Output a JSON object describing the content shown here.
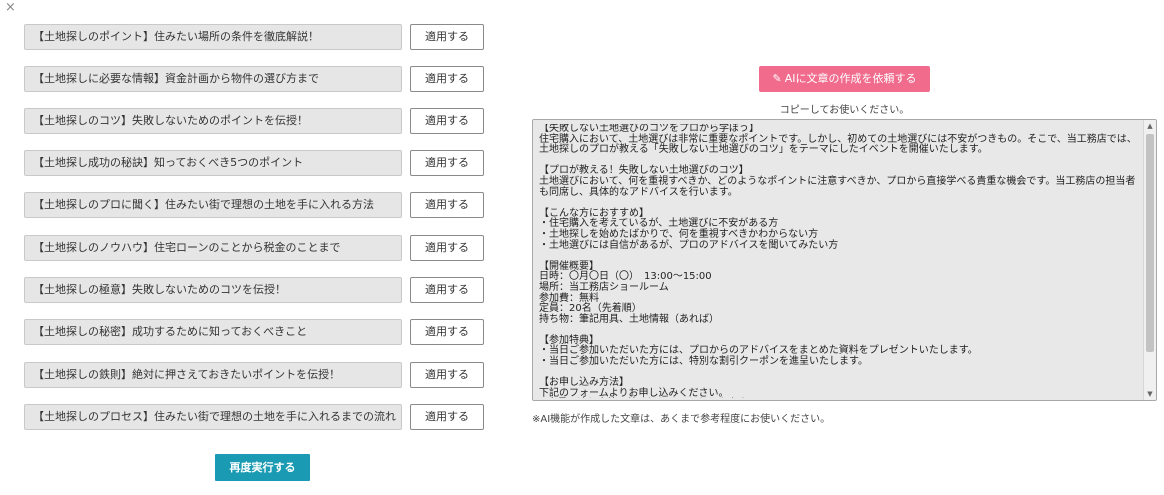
{
  "close_symbol": "×",
  "titles": [
    {
      "text": "【土地探しのポイント】住みたい場所の条件を徹底解説！",
      "apply_label": "適用する"
    },
    {
      "text": "【土地探しに必要な情報】資金計画から物件の選び方まで",
      "apply_label": "適用する"
    },
    {
      "text": "【土地探しのコツ】失敗しないためのポイントを伝授！",
      "apply_label": "適用する"
    },
    {
      "text": "【土地探し成功の秘訣】知っておくべき5つのポイント",
      "apply_label": "適用する"
    },
    {
      "text": "【土地探しのプロに聞く】住みたい街で理想の土地を手に入れる方法",
      "apply_label": "適用する"
    },
    {
      "text": "【土地探しのノウハウ】住宅ローンのことから税金のことまで",
      "apply_label": "適用する"
    },
    {
      "text": "【土地探しの極意】失敗しないためのコツを伝授！",
      "apply_label": "適用する"
    },
    {
      "text": "【土地探しの秘密】成功するために知っておくべきこと",
      "apply_label": "適用する"
    },
    {
      "text": "【土地探しの鉄則】絶対に押さえておきたいポイントを伝授！",
      "apply_label": "適用する"
    },
    {
      "text": "【土地探しのプロセス】住みたい街で理想の土地を手に入れるまでの流れ",
      "apply_label": "適用する"
    }
  ],
  "rerun_label": "再度実行する",
  "ai_button_label": "AIに文章の作成を依頼する",
  "copy_note": "コピーしてお使いください。",
  "generated_text": "【失敗しない土地選びのコツをプロから学ぼう】\n住宅購入において、土地選びは非常に重要なポイントです。しかし、初めての土地選びには不安がつきもの。そこで、当工務店では、土地探しのプロが教える「失敗しない土地選びのコツ」をテーマにしたイベントを開催いたします。\n\n【プロが教える！失敗しない土地選びのコツ】\n土地選びにおいて、何を重視すべきか、どのようなポイントに注意すべきか、プロから直接学べる貴重な機会です。当工務店の担当者も同席し、具体的なアドバイスを行います。\n\n【こんな方におすすめ】\n・住宅購入を考えているが、土地選びに不安がある方\n・土地探しを始めたばかりで、何を重視すべきかわからない方\n・土地選びには自信があるが、プロのアドバイスを聞いてみたい方\n\n【開催概要】\n日時：〇月〇日（〇）　13:00～15:00\n場所：当工務店ショールーム\n参加費：無料\n定員：20名（先着順）\n持ち物：筆記用具、土地情報（あれば）\n\n【参加特典】\n・当日ご参加いただいた方には、プロからのアドバイスをまとめた資料をプレゼントいたします。\n・当日ご参加いただいた方には、特別な割引クーポンを進呈いたします。\n\n【お申し込み方法】\n下記のフォームよりお申し込みください。\n※定員に達し次第、締め切らせていただきます。",
  "disclaimer": "※AI機能が作成した文章は、あくまで参考程度にお使いください。",
  "colors": {
    "ai_button": "#f06b8c",
    "rerun_button": "#1a9bb3",
    "title_box_bg": "#e6e6e6",
    "textarea_bg": "#e8e8e8"
  },
  "icons": {
    "close": "close-icon",
    "ai_wand": "magic-wand-icon",
    "scroll_up": "chevron-up-icon",
    "scroll_down": "chevron-down-icon"
  }
}
